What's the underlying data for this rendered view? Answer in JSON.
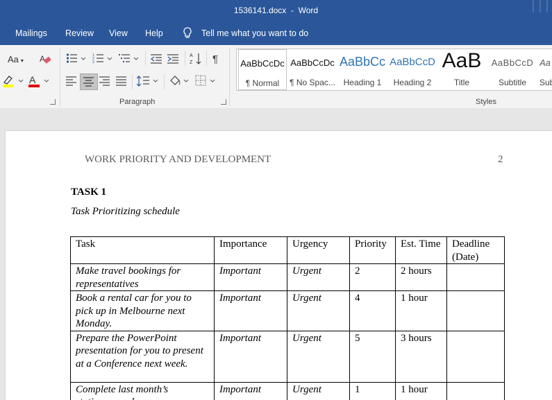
{
  "window": {
    "title": "1536141.docx  -  Word"
  },
  "tabs": [
    "Mailings",
    "Review",
    "View",
    "Help"
  ],
  "tell_me": {
    "text": "Tell me what you want to do"
  },
  "ribbon": {
    "font_case_label": "Aa",
    "paragraph_group_label": "Paragraph",
    "styles_group_label": "Styles",
    "styles": [
      {
        "sample": "AaBbCcDc",
        "name": "¶ Normal"
      },
      {
        "sample": "AaBbCcDc",
        "name": "¶ No Spac..."
      },
      {
        "sample": "AaBbCc",
        "name": "Heading 1"
      },
      {
        "sample": "AaBbCcD",
        "name": "Heading 2"
      },
      {
        "sample": "AaB",
        "name": "Title"
      },
      {
        "sample": "AaBbCcD",
        "name": "Subtitle"
      },
      {
        "sample": "Aa",
        "name": "Sub"
      }
    ],
    "colors": {
      "highlight": "#ffff00",
      "font_color": "#e00000",
      "accent": "#2b579a"
    }
  },
  "document": {
    "running_head": "WORK PRIORITY AND DEVELOPMENT",
    "page_number": "2",
    "heading": "TASK 1",
    "subheading": "Task Prioritizing schedule",
    "table": {
      "headers": [
        "Task",
        "Importance",
        "Urgency",
        "Priority",
        "Est. Time",
        "Deadline (Date)"
      ],
      "rows": [
        [
          "Make travel bookings for representatives",
          "Important",
          "Urgent",
          "2",
          "2 hours",
          ""
        ],
        [
          "Book a rental car for you to pick up in Melbourne next Monday.",
          "Important",
          "Urgent",
          "4",
          "1 hour",
          ""
        ],
        [
          "Prepare the PowerPoint presentation for you to present at a Conference next week.",
          "Important",
          "Urgent",
          "5",
          "3 hours",
          ""
        ],
        [
          "Complete last month’s stationery order",
          "Important",
          "Urgent",
          "1",
          "1 hour",
          ""
        ]
      ]
    }
  }
}
